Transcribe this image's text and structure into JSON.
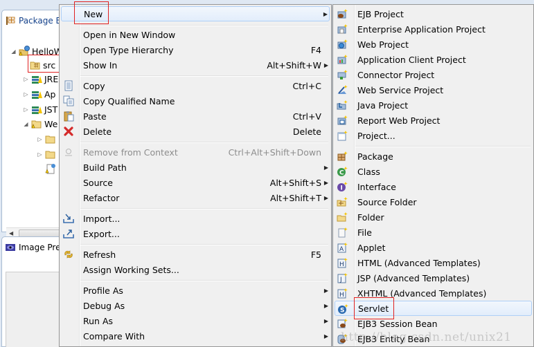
{
  "package_explorer": {
    "tab_title": "Package E...",
    "tree": [
      {
        "label": "HelloW",
        "icon": "web-project-icon",
        "expanded": true,
        "level": 0
      },
      {
        "label": "src",
        "icon": "source-folder-icon",
        "level": 1,
        "highlighted": true
      },
      {
        "label": "JRE",
        "icon": "library-icon",
        "expanded": false,
        "level": 1
      },
      {
        "label": "Ap",
        "icon": "library-icon",
        "expanded": false,
        "level": 1
      },
      {
        "label": "JST",
        "icon": "library-icon",
        "expanded": false,
        "level": 1
      },
      {
        "label": "We",
        "icon": "folder-icon",
        "expanded": true,
        "level": 1
      },
      {
        "label": "",
        "icon": "folder-icon",
        "expanded": false,
        "level": 2
      },
      {
        "label": "",
        "icon": "folder-icon",
        "expanded": false,
        "level": 2
      },
      {
        "label": "",
        "icon": "web-file-icon",
        "level": 2
      }
    ]
  },
  "image_preview": {
    "tab_title": "Image Prev"
  },
  "context_menu": {
    "items": [
      {
        "label": "New",
        "shortcut": "",
        "submenu": true,
        "highlighted": true
      },
      {
        "label": "Open in New Window",
        "shortcut": ""
      },
      {
        "label": "Open Type Hierarchy",
        "shortcut": "F4"
      },
      {
        "label": "Show In",
        "shortcut": "Alt+Shift+W",
        "submenu": true
      },
      {
        "label": "Copy",
        "shortcut": "Ctrl+C",
        "icon": "copy-icon"
      },
      {
        "label": "Copy Qualified Name",
        "shortcut": "",
        "icon": "copy-qualified-icon"
      },
      {
        "label": "Paste",
        "shortcut": "Ctrl+V",
        "icon": "paste-icon"
      },
      {
        "label": "Delete",
        "shortcut": "Delete",
        "icon": "delete-icon"
      },
      {
        "label": "Remove from Context",
        "shortcut": "Ctrl+Alt+Shift+Down",
        "icon": "remove-context-icon",
        "disabled": true
      },
      {
        "label": "Build Path",
        "shortcut": "",
        "submenu": true
      },
      {
        "label": "Source",
        "shortcut": "Alt+Shift+S",
        "submenu": true
      },
      {
        "label": "Refactor",
        "shortcut": "Alt+Shift+T",
        "submenu": true
      },
      {
        "label": "Import...",
        "shortcut": "",
        "icon": "import-icon"
      },
      {
        "label": "Export...",
        "shortcut": "",
        "icon": "export-icon"
      },
      {
        "label": "Refresh",
        "shortcut": "F5",
        "icon": "refresh-icon"
      },
      {
        "label": "Assign Working Sets...",
        "shortcut": ""
      },
      {
        "label": "Profile As",
        "shortcut": "",
        "submenu": true
      },
      {
        "label": "Debug As",
        "shortcut": "",
        "submenu": true
      },
      {
        "label": "Run As",
        "shortcut": "",
        "submenu": true
      },
      {
        "label": "Compare With",
        "shortcut": "",
        "submenu": true
      }
    ]
  },
  "new_submenu": {
    "items": [
      {
        "label": "EJB Project",
        "icon": "ejb-project-icon"
      },
      {
        "label": "Enterprise Application Project",
        "icon": "enterprise-app-project-icon"
      },
      {
        "label": "Web Project",
        "icon": "web-project-icon"
      },
      {
        "label": "Application Client Project",
        "icon": "app-client-project-icon"
      },
      {
        "label": "Connector Project",
        "icon": "connector-project-icon"
      },
      {
        "label": "Web Service Project",
        "icon": "web-service-project-icon"
      },
      {
        "label": "Java Project",
        "icon": "java-project-icon"
      },
      {
        "label": "Report Web Project",
        "icon": "report-web-project-icon"
      },
      {
        "label": "Project...",
        "icon": "project-icon"
      },
      {
        "label": "Package",
        "icon": "package-icon"
      },
      {
        "label": "Class",
        "icon": "class-icon"
      },
      {
        "label": "Interface",
        "icon": "interface-icon"
      },
      {
        "label": "Source Folder",
        "icon": "source-folder-icon"
      },
      {
        "label": "Folder",
        "icon": "folder-icon"
      },
      {
        "label": "File",
        "icon": "file-icon"
      },
      {
        "label": "Applet",
        "icon": "applet-icon"
      },
      {
        "label": "HTML (Advanced Templates)",
        "icon": "html-icon"
      },
      {
        "label": "JSP (Advanced Templates)",
        "icon": "jsp-icon"
      },
      {
        "label": "XHTML (Advanced Templates)",
        "icon": "xhtml-icon"
      },
      {
        "label": "Servlet",
        "icon": "servlet-icon",
        "highlighted": true
      },
      {
        "label": "EJB3 Session Bean",
        "icon": "session-bean-icon"
      },
      {
        "label": "EJB3 Entity Bean",
        "icon": "entity-bean-icon"
      }
    ]
  },
  "watermark": "http://blog.csdn.net/unix21",
  "colors": {
    "menu_bg": "#f0f0f0",
    "highlight_border": "#aecff7",
    "annotation_red": "#e02020",
    "panel_title": "#15428b"
  }
}
